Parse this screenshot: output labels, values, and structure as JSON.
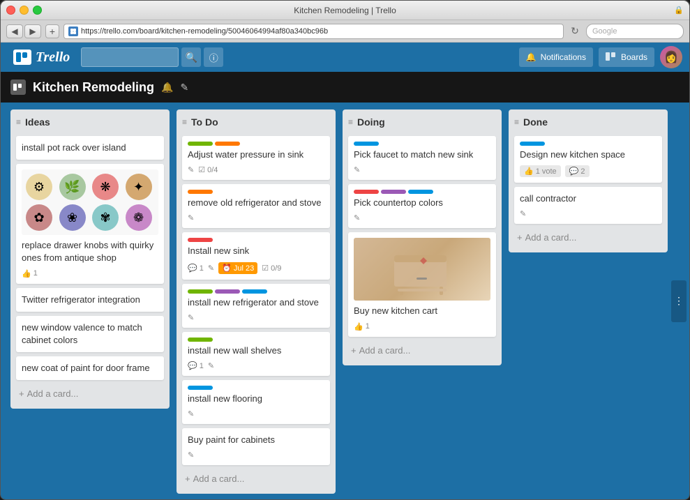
{
  "window": {
    "title": "Kitchen Remodeling | Trello",
    "url": "https://trello.com/board/kitchen-remodeling/50046064994af80a340bc96b"
  },
  "nav": {
    "search_placeholder": "",
    "notifications_label": "Notifications",
    "boards_label": "Boards"
  },
  "board": {
    "title": "Kitchen Remodeling",
    "icon": "🍴"
  },
  "columns": [
    {
      "id": "ideas",
      "title": "Ideas",
      "label_color": "#888",
      "cards": [
        {
          "id": "c1",
          "title": "install pot rack over island",
          "has_image": false,
          "knobs": true,
          "labels": [],
          "meta": []
        },
        {
          "id": "c2",
          "title": "replace drawer knobs with quirky ones from antique shop",
          "has_image": false,
          "knobs": false,
          "labels": [],
          "meta": [
            {
              "type": "votes",
              "count": "1"
            }
          ]
        },
        {
          "id": "c3",
          "title": "Twitter refrigerator integration",
          "has_image": false,
          "knobs": false,
          "labels": [],
          "meta": []
        },
        {
          "id": "c4",
          "title": "new window valence to match cabinet colors",
          "has_image": false,
          "knobs": false,
          "labels": [],
          "meta": []
        },
        {
          "id": "c5",
          "title": "new coat of paint for door frame",
          "has_image": false,
          "knobs": false,
          "labels": [],
          "meta": []
        }
      ],
      "add_label": "Add a card..."
    },
    {
      "id": "todo",
      "title": "To Do",
      "label_color": "#70b500",
      "cards": [
        {
          "id": "t1",
          "title": "Adjust water pressure in sink",
          "labels": [
            {
              "color": "#70b500"
            },
            {
              "color": "#ff7800"
            }
          ],
          "meta": [
            {
              "type": "edit"
            },
            {
              "type": "checklist",
              "text": "0/4"
            }
          ]
        },
        {
          "id": "t2",
          "title": "remove old refrigerator and stove",
          "labels": [
            {
              "color": "#ff7800"
            }
          ],
          "meta": [
            {
              "type": "edit"
            }
          ]
        },
        {
          "id": "t3",
          "title": "Install new sink",
          "labels": [
            {
              "color": "#e44"
            }
          ],
          "meta": [
            {
              "type": "comments",
              "count": "1"
            },
            {
              "type": "edit"
            },
            {
              "type": "due",
              "text": "Jul 23"
            },
            {
              "type": "checklist",
              "text": "0/9"
            }
          ]
        },
        {
          "id": "t4",
          "title": "install new refrigerator and stove",
          "labels": [
            {
              "color": "#70b500"
            },
            {
              "color": "#9b59b6"
            },
            {
              "color": "#0095e0"
            }
          ],
          "meta": [
            {
              "type": "edit"
            }
          ]
        },
        {
          "id": "t5",
          "title": "install new wall shelves",
          "labels": [
            {
              "color": "#70b500"
            }
          ],
          "meta": [
            {
              "type": "comments",
              "count": "1"
            },
            {
              "type": "edit"
            }
          ]
        },
        {
          "id": "t6",
          "title": "install new flooring",
          "labels": [
            {
              "color": "#0095e0"
            }
          ],
          "meta": [
            {
              "type": "edit"
            }
          ]
        },
        {
          "id": "t7",
          "title": "Buy paint for cabinets",
          "labels": [],
          "meta": [
            {
              "type": "edit"
            }
          ]
        }
      ],
      "add_label": "Add a card..."
    },
    {
      "id": "doing",
      "title": "Doing",
      "label_color": "#9b59b6",
      "cards": [
        {
          "id": "d1",
          "title": "Pick faucet to match new sink",
          "labels": [
            {
              "color": "#0095e0"
            }
          ],
          "meta": [
            {
              "type": "edit"
            }
          ]
        },
        {
          "id": "d2",
          "title": "Pick countertop colors",
          "labels": [
            {
              "color": "#e44"
            },
            {
              "color": "#9b59b6"
            },
            {
              "color": "#0095e0"
            }
          ],
          "meta": [
            {
              "type": "edit"
            }
          ]
        },
        {
          "id": "d3",
          "title": "Buy new kitchen cart",
          "has_cart": true,
          "labels": [],
          "meta": [
            {
              "type": "votes",
              "count": "1"
            }
          ]
        }
      ],
      "add_label": "Add a card..."
    },
    {
      "id": "done",
      "title": "Done",
      "label_color": "#e44",
      "cards": [
        {
          "id": "dn1",
          "title": "Design new kitchen space",
          "labels": [
            {
              "color": "#0095e0"
            }
          ],
          "meta": [
            {
              "type": "votes",
              "count": "1 vote"
            },
            {
              "type": "comments",
              "count": "2"
            }
          ]
        },
        {
          "id": "dn2",
          "title": "call contractor",
          "labels": [],
          "meta": [
            {
              "type": "edit"
            }
          ]
        }
      ],
      "add_label": "Add a card..."
    }
  ]
}
